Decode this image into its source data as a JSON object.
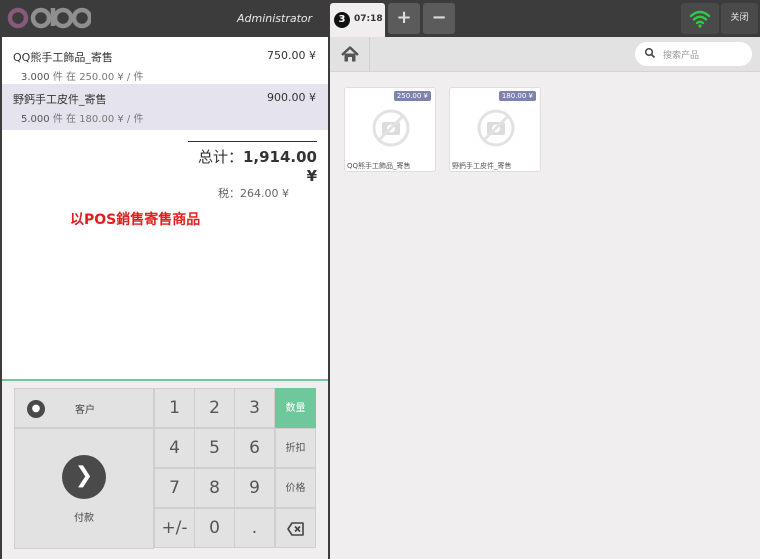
{
  "topbar": {
    "logo_text": "odoo",
    "cashier": "Administrator",
    "order_number": "3",
    "order_time": "07:18",
    "add_order": "+",
    "remove_order": "−",
    "close_label": "关闭"
  },
  "order": {
    "lines": [
      {
        "name": "QQ熊手工飾品_寄售",
        "price": "750.00 ¥",
        "qty": "3.000",
        "unit": "件",
        "info": "在 250.00 ¥ / 件",
        "selected": false
      },
      {
        "name": "野鈣手工皮件_寄售",
        "price": "900.00 ¥",
        "qty": "5.000",
        "unit": "件",
        "info": "在 180.00 ¥ / 件",
        "selected": true
      }
    ],
    "total_label": "总计：",
    "total_value": "1,914.00 ¥",
    "tax_label": "税：",
    "tax_value": "264.00 ¥"
  },
  "annotation": "以POS銷售寄售商品",
  "numpad": {
    "customer_label": "客户",
    "payment_label": "付款",
    "payment_icon": "chevron-right-icon",
    "keys": [
      "1",
      "2",
      "3",
      "4",
      "5",
      "6",
      "7",
      "8",
      "9",
      "+/-",
      "0",
      "."
    ],
    "mode_qty": "数量",
    "mode_disc": "折扣",
    "mode_price": "价格",
    "active_mode": "数量"
  },
  "products_panel": {
    "search_placeholder": "搜索产品",
    "products": [
      {
        "name": "QQ熊手工飾品_寄售",
        "price": "250.00 ¥"
      },
      {
        "name": "野鈣手工皮件_寄售",
        "price": "180.00 ¥"
      }
    ]
  },
  "colors": {
    "accent_green": "#6ec89b",
    "badge": "#7f82ac",
    "annotation": "#e02020",
    "wifi": "#2ecc40"
  }
}
